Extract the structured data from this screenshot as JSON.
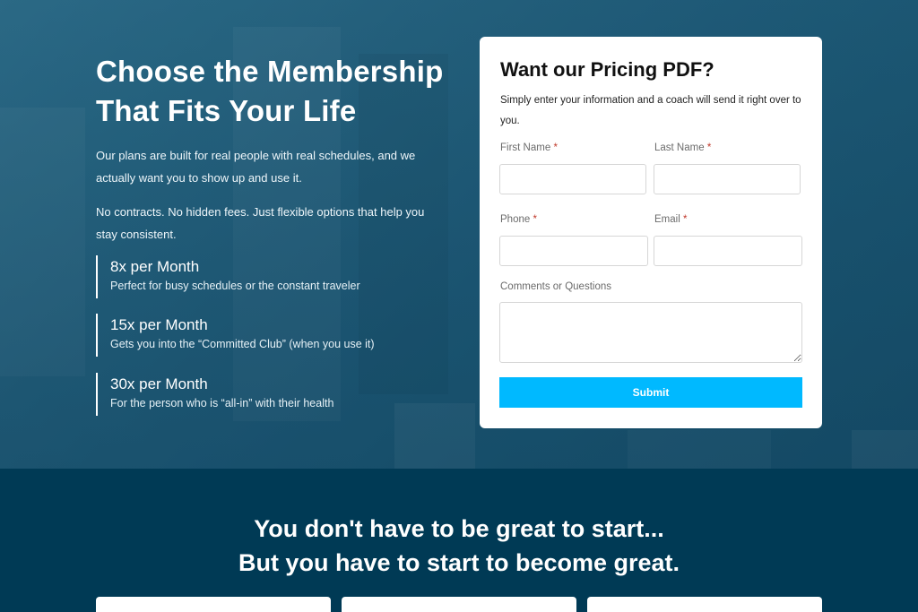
{
  "hero": {
    "title_line1": "Choose the Membership",
    "title_line2": "That Fits Your Life",
    "paragraph1": "Our plans are built for real people with real schedules, and we actually want you to show up and use it.",
    "paragraph2": "No contracts. No hidden fees. Just flexible options that help you stay consistent."
  },
  "plans": [
    {
      "title": "8x per Month",
      "desc": "Perfect for busy schedules or the constant traveler"
    },
    {
      "title": "15x per Month",
      "desc": "Gets you into the “Committed Club” (when you use it)"
    },
    {
      "title": "30x per Month",
      "desc": "For the person who is “all-in” with their health"
    }
  ],
  "form": {
    "title": "Want our Pricing PDF?",
    "description": "Simply enter your information and a coach will send it right over to you.",
    "first_name_label": "First Name",
    "last_name_label": "Last Name",
    "phone_label": "Phone",
    "email_label": "Email",
    "comments_label": "Comments or Questions",
    "required_mark": "*",
    "submit_label": "Submit"
  },
  "bottom": {
    "quote_line1": "You don't have to be great to start...",
    "quote_line2": "But you have to start to become great."
  },
  "colors": {
    "accent": "#00b9ff",
    "dark_bg": "#003a55"
  }
}
